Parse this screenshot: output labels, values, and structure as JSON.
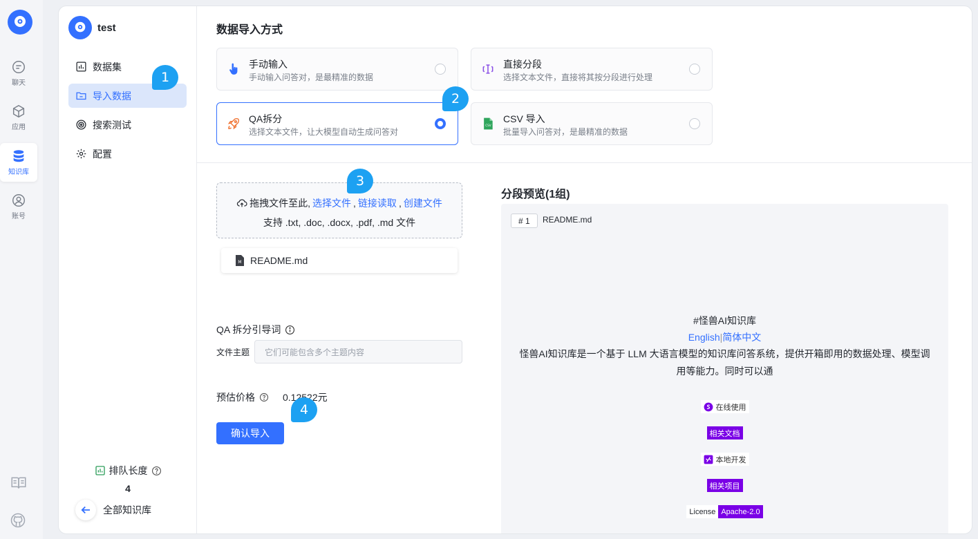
{
  "rail": {
    "items": [
      {
        "label": "聊天",
        "icon": "chat-icon"
      },
      {
        "label": "应用",
        "icon": "cube-icon"
      },
      {
        "label": "知识库",
        "icon": "database-icon"
      },
      {
        "label": "账号",
        "icon": "user-icon"
      }
    ],
    "bottom_icons": [
      "book-icon",
      "github-icon"
    ]
  },
  "dataset": {
    "name": "test",
    "menu": [
      {
        "label": "数据集",
        "icon": "chart-icon"
      },
      {
        "label": "导入数据",
        "icon": "folder-icon"
      },
      {
        "label": "搜索测试",
        "icon": "target-icon"
      },
      {
        "label": "配置",
        "icon": "gear-icon"
      }
    ],
    "queue_label": "排队长度",
    "queue_value": "4",
    "back_label": "全部知识库"
  },
  "import": {
    "title": "数据导入方式",
    "modes": [
      {
        "title": "手动输入",
        "desc": "手动输入问答对，是最精准的数据",
        "icon": "hand-icon",
        "selected": false
      },
      {
        "title": "直接分段",
        "desc": "选择文本文件，直接将其按分段进行处理",
        "icon": "text-cursor-icon",
        "selected": false
      },
      {
        "title": "QA拆分",
        "desc": "选择文本文件，让大模型自动生成问答对",
        "icon": "rocket-icon",
        "selected": true
      },
      {
        "title": "CSV 导入",
        "desc": "批量导入问答对，是最精准的数据",
        "icon": "csv-file-icon",
        "selected": false
      }
    ]
  },
  "upload": {
    "prefix": "拖拽文件至此,",
    "choose": "选择文件",
    "sep1": ",",
    "link": "链接读取",
    "sep2": ",",
    "create": "创建文件",
    "support": "支持 .txt, .doc, .docx, .pdf, .md 文件",
    "file": "README.md"
  },
  "qa": {
    "prompt_label": "QA 拆分引导词",
    "topic_label": "文件主题",
    "topic_placeholder": "它们可能包含多个主题内容",
    "price_label": "预估价格",
    "price_value": "0.12522元",
    "confirm": "确认导入"
  },
  "preview": {
    "title": "分段预览(1组)",
    "index": "# 1",
    "file": "README.md",
    "heading": "#怪兽AI知识库",
    "lang_en": "English",
    "lang_sep": "|",
    "lang_zh": "简体中文",
    "desc": "怪兽AI知识库是一个基于 LLM 大语言模型的知识库问答系统，提供开箱即用的数据处理、模型调用等能力。同时可以通",
    "badges": {
      "online": "在线使用",
      "docs": "相关文档",
      "local": "本地开发",
      "projects": "相关项目",
      "license_key": "License",
      "license_val": "Apache-2.0"
    }
  },
  "callouts": [
    "1",
    "2",
    "3",
    "4"
  ],
  "colors": {
    "accent": "#3370ff",
    "callout": "#1da1f2",
    "badge_purple": "#7a00e6"
  }
}
